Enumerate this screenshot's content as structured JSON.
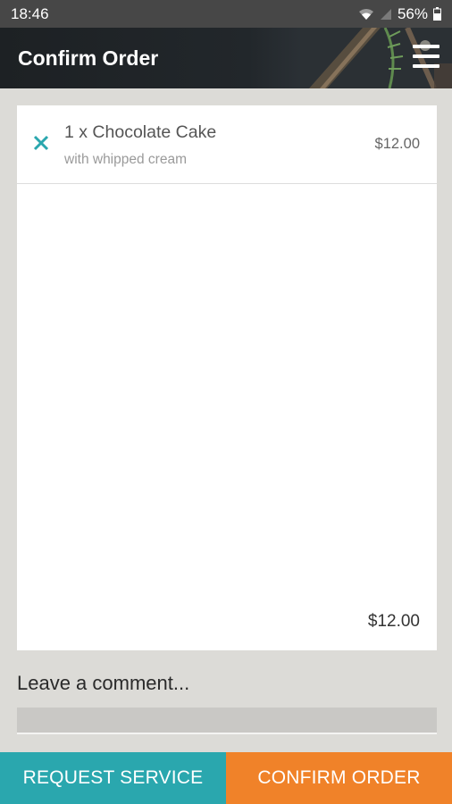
{
  "status_bar": {
    "time": "18:46",
    "battery": "56%",
    "icons": [
      "wifi-icon",
      "signal-icon",
      "battery-icon"
    ]
  },
  "app_bar": {
    "title": "Confirm Order",
    "menu_icon": "hamburger-menu-icon"
  },
  "order": {
    "items": [
      {
        "name": "1 x Chocolate Cake",
        "note": "with whipped cream",
        "price": "$12.00",
        "remove_icon": "close-icon"
      }
    ],
    "total": "$12.00"
  },
  "comment": {
    "label": "Leave a comment...",
    "value": ""
  },
  "actions": {
    "request_service": "REQUEST SERVICE",
    "confirm_order": "CONFIRM ORDER"
  },
  "colors": {
    "accent_teal": "#2aa7ae",
    "accent_orange": "#f08229",
    "background": "#dcdbd7",
    "header": "#1d2124"
  }
}
